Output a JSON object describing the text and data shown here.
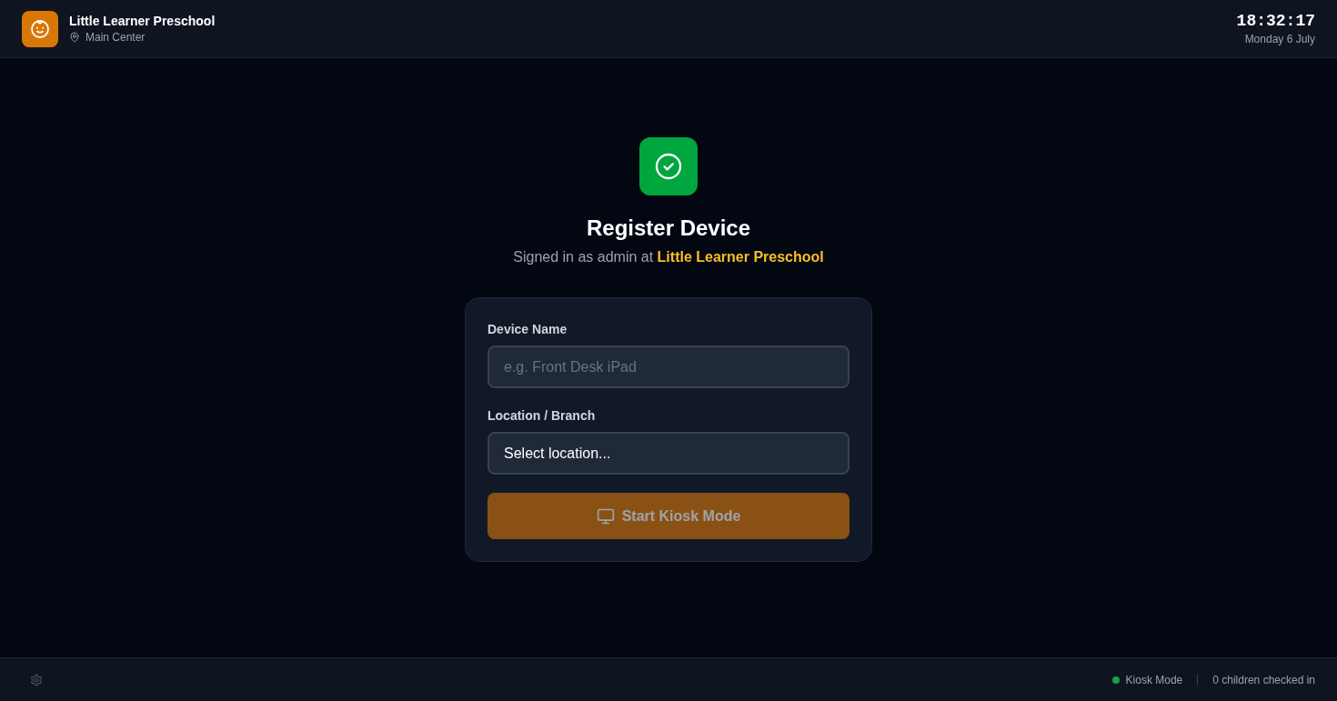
{
  "header": {
    "school_name": "Little Learner Preschool",
    "location": "Main Center",
    "time": "18:32:17",
    "date": "Monday 6 July"
  },
  "register": {
    "title": "Register Device",
    "subtitle": "Signed in as admin at",
    "organization": "Little Learner Preschool"
  },
  "form": {
    "fields": [
      {
        "kind": "text",
        "label": "Device Name",
        "placeholder": "e.g. Front Desk iPad"
      },
      {
        "kind": "select",
        "label": "Location / Branch",
        "value": "Select location..."
      }
    ],
    "button": {
      "label": "Start Kiosk Mode",
      "disabled": true
    }
  },
  "footer": {
    "kiosk": {
      "label": "Kiosk Mode",
      "active": true
    },
    "checked_in": "0 children checked in"
  }
}
